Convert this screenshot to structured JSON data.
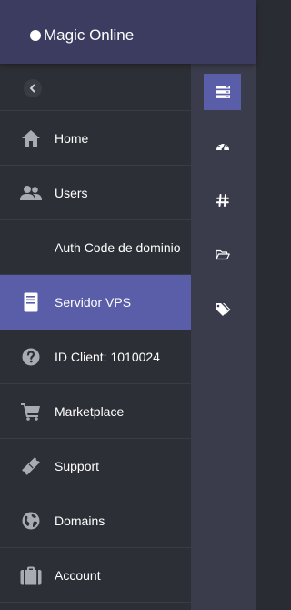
{
  "header": {
    "brand_name": "Magic Online"
  },
  "sidebar": {
    "collapse_icon": "chevron-left-icon",
    "items": [
      {
        "label": "Home",
        "icon": "home-icon",
        "active": false
      },
      {
        "label": "Users",
        "icon": "users-icon",
        "active": false
      },
      {
        "label": "Auth Code de dominio",
        "icon": "",
        "active": false
      },
      {
        "label": "Servidor VPS",
        "icon": "server-document-icon",
        "active": true
      },
      {
        "label": "ID Client: 1010024",
        "icon": "question-circle-icon",
        "active": false
      },
      {
        "label": "Marketplace",
        "icon": "cart-icon",
        "active": false
      },
      {
        "label": "Support",
        "icon": "ticket-icon",
        "active": false
      },
      {
        "label": "Domains",
        "icon": "globe-icon",
        "active": false
      },
      {
        "label": "Account",
        "icon": "briefcase-icon",
        "active": false
      }
    ]
  },
  "rail": {
    "items": [
      {
        "icon": "server-stack-icon",
        "active": true
      },
      {
        "icon": "dashboard-gauge-icon",
        "active": false
      },
      {
        "icon": "hashtag-icon",
        "active": false
      },
      {
        "icon": "folder-open-icon",
        "active": false
      },
      {
        "icon": "tags-icon",
        "active": false
      }
    ]
  },
  "colors": {
    "header_bg": "#3b3c5f",
    "sidebar_bg": "#2d2f36",
    "rail_bg": "#3b3c4b",
    "accent": "#5a5ea8",
    "icon_gray": "#a9abb3",
    "text": "#ffffff"
  }
}
